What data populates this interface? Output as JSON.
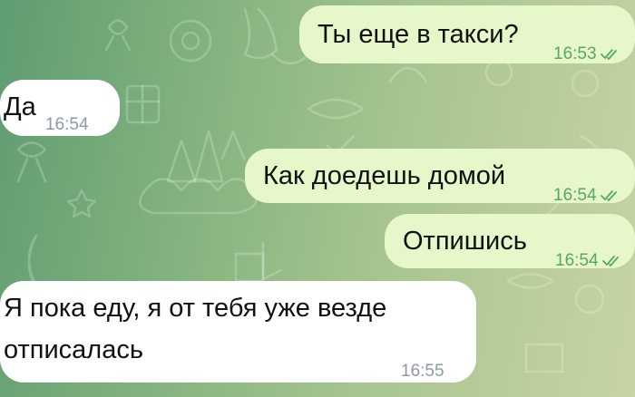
{
  "chat": {
    "messages": [
      {
        "direction": "outgoing",
        "text": "Ты еще в такси?",
        "time": "16:53",
        "status": "read"
      },
      {
        "direction": "incoming",
        "text": "Да",
        "time": "16:54"
      },
      {
        "direction": "outgoing",
        "text": "Как доедешь домой",
        "time": "16:54",
        "status": "read"
      },
      {
        "direction": "outgoing",
        "text": "Отпишись",
        "time": "16:54",
        "status": "read"
      },
      {
        "direction": "incoming",
        "text_line1": "Я пока еду, я от тебя уже везде",
        "text_line2": "отписалась",
        "time": "16:55"
      }
    ]
  },
  "colors": {
    "outgoing_bubble": "#e6f8c9",
    "incoming_bubble": "#ffffff",
    "read_tick": "#5aa663",
    "wallpaper_start": "#5f9c72",
    "wallpaper_end": "#c7d4a4"
  },
  "icons": [
    "double-check-icon"
  ]
}
